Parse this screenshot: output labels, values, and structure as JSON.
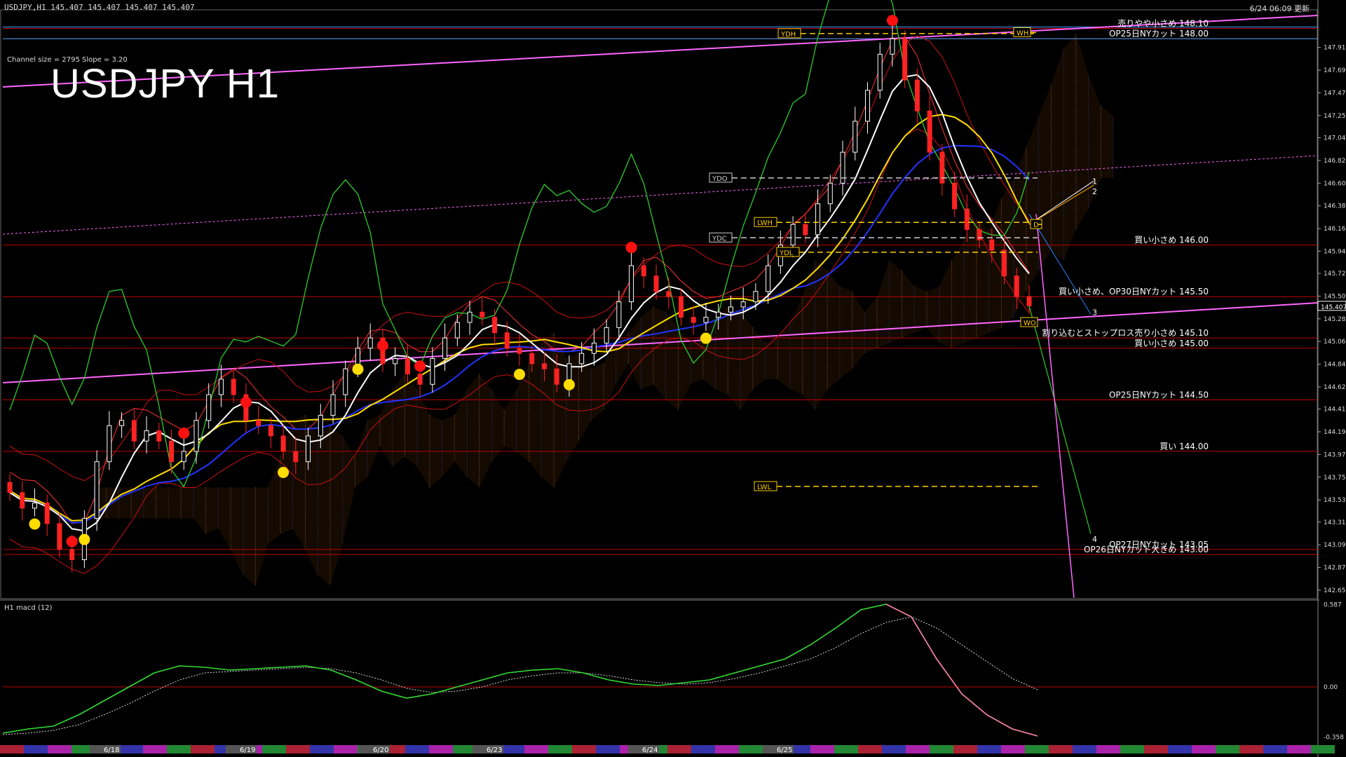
{
  "header": {
    "symbol_line": "USDJPY,H1  145.407 145.407 145.407 145.407",
    "channel_info": "Channel size = 2795 Slope = 3.20",
    "big_title": "USDJPY H1",
    "timestamp": "6/24 06:09 更新",
    "macd_label": "H1  macd (12)"
  },
  "colors": {
    "background": "#000000",
    "bull_candle": "#ffffff",
    "bear_candle": "#ff2222",
    "hline": "#c00000",
    "magenta": "#ff66ff",
    "green": "#2ecc2e",
    "yellow": "#ffdd00",
    "blue": "#2233ff",
    "white_ma": "#ffffff",
    "macd_line": "#33dd33",
    "macd_fall": "#ff77aa"
  },
  "chart_data": [
    {
      "type": "line",
      "title": "USDJPY H1",
      "price_axis": {
        "ylim": [
          142.58,
          148.28
        ],
        "ticks": [
          147.915,
          147.695,
          147.475,
          147.255,
          147.04,
          146.82,
          146.6,
          146.38,
          146.16,
          145.94,
          145.725,
          145.505,
          145.285,
          145.065,
          144.845,
          144.625,
          144.41,
          144.19,
          143.97,
          143.75,
          143.53,
          143.315,
          143.095,
          142.875,
          142.655
        ],
        "current_price_label": "145.407",
        "current_price": 145.407
      },
      "date_labels": [
        "6/18",
        "6/19",
        "6/20",
        "6/23",
        "6/24",
        "6/25"
      ],
      "levels": [
        {
          "price": 148.1,
          "label": "売りやや小さめ 148.10"
        },
        {
          "price": 148.0,
          "label": "OP25日NYカット 148.00"
        },
        {
          "price": 146.0,
          "label": "買い小さめ 146.00"
        },
        {
          "price": 145.5,
          "label": "買い小さめ、OP30日NYカット 145.50"
        },
        {
          "price": 145.1,
          "label": "割り込むとストップロス売り小さめ 145.10"
        },
        {
          "price": 145.0,
          "label": "買い小さめ 145.00"
        },
        {
          "price": 144.5,
          "label": "OP25日NYカット 144.50"
        },
        {
          "price": 144.0,
          "label": "買い 144.00"
        },
        {
          "price": 143.05,
          "label": "OP27日NYカット 143.05"
        },
        {
          "price": 143.0,
          "label": "OP26日NYカット大きめ 143.00"
        }
      ],
      "box_labels": [
        {
          "label": "YDH",
          "price": 148.05
        },
        {
          "label": "YDO",
          "price": 146.65
        },
        {
          "label": "LWH",
          "price": 146.22
        },
        {
          "label": "YDC",
          "price": 146.07
        },
        {
          "label": "YDL",
          "price": 145.93
        },
        {
          "label": "LWL",
          "price": 143.66
        },
        {
          "label": "WH",
          "price": 148.06
        },
        {
          "label": "WO",
          "price": 145.25
        },
        {
          "label": "D",
          "price": 146.2
        }
      ],
      "projection_labels": [
        "1",
        "2",
        "3",
        "4"
      ],
      "close_series": [
        143.6,
        143.45,
        143.5,
        143.3,
        143.05,
        142.95,
        143.35,
        143.9,
        144.25,
        144.3,
        144.1,
        144.2,
        144.1,
        143.9,
        144.0,
        144.3,
        144.55,
        144.7,
        144.55,
        144.3,
        144.25,
        144.15,
        144.0,
        143.9,
        144.15,
        144.35,
        144.55,
        144.8,
        145.0,
        145.1,
        144.85,
        144.9,
        144.75,
        144.65,
        144.9,
        145.1,
        145.25,
        145.35,
        145.3,
        145.15,
        145.0,
        144.95,
        144.85,
        144.8,
        144.65,
        144.85,
        144.95,
        145.05,
        145.2,
        145.45,
        145.8,
        145.7,
        145.55,
        145.5,
        145.3,
        145.25,
        145.3,
        145.35,
        145.4,
        145.45,
        145.55,
        145.8,
        146.0,
        146.2,
        146.1,
        146.4,
        146.6,
        146.9,
        147.2,
        147.5,
        147.85,
        148.0,
        147.6,
        147.3,
        146.9,
        146.6,
        146.35,
        146.15,
        146.05,
        145.95,
        145.7,
        145.5,
        145.41
      ],
      "indicators": [
        "ichimoku cloud",
        "moving averages",
        "bollinger bands",
        "channel lines"
      ],
      "grid": false
    },
    {
      "type": "line",
      "title": "H1  macd (12)",
      "ylim": [
        -0.4,
        0.6
      ],
      "ticks": [
        0.587,
        0.0,
        -0.358
      ],
      "series": [
        {
          "values": [
            -0.33,
            -0.3,
            -0.28,
            -0.2,
            -0.1,
            0.0,
            0.1,
            0.15,
            0.14,
            0.12,
            0.13,
            0.14,
            0.15,
            0.12,
            0.05,
            -0.03,
            -0.08,
            -0.05,
            0.0,
            0.05,
            0.1,
            0.12,
            0.13,
            0.1,
            0.05,
            0.02,
            0.01,
            0.03,
            0.05,
            0.1,
            0.15,
            0.2,
            0.3,
            0.42,
            0.55,
            0.59,
            0.5,
            0.2,
            -0.05,
            -0.2,
            -0.3,
            -0.35
          ]
        },
        {
          "values": [
            -0.34,
            -0.33,
            -0.31,
            -0.27,
            -0.2,
            -0.12,
            -0.03,
            0.05,
            0.1,
            0.11,
            0.12,
            0.13,
            0.14,
            0.13,
            0.1,
            0.05,
            -0.01,
            -0.04,
            -0.03,
            0.0,
            0.05,
            0.08,
            0.1,
            0.1,
            0.08,
            0.05,
            0.03,
            0.02,
            0.03,
            0.06,
            0.1,
            0.15,
            0.2,
            0.28,
            0.38,
            0.46,
            0.5,
            0.42,
            0.3,
            0.18,
            0.06,
            -0.02
          ]
        }
      ]
    }
  ]
}
